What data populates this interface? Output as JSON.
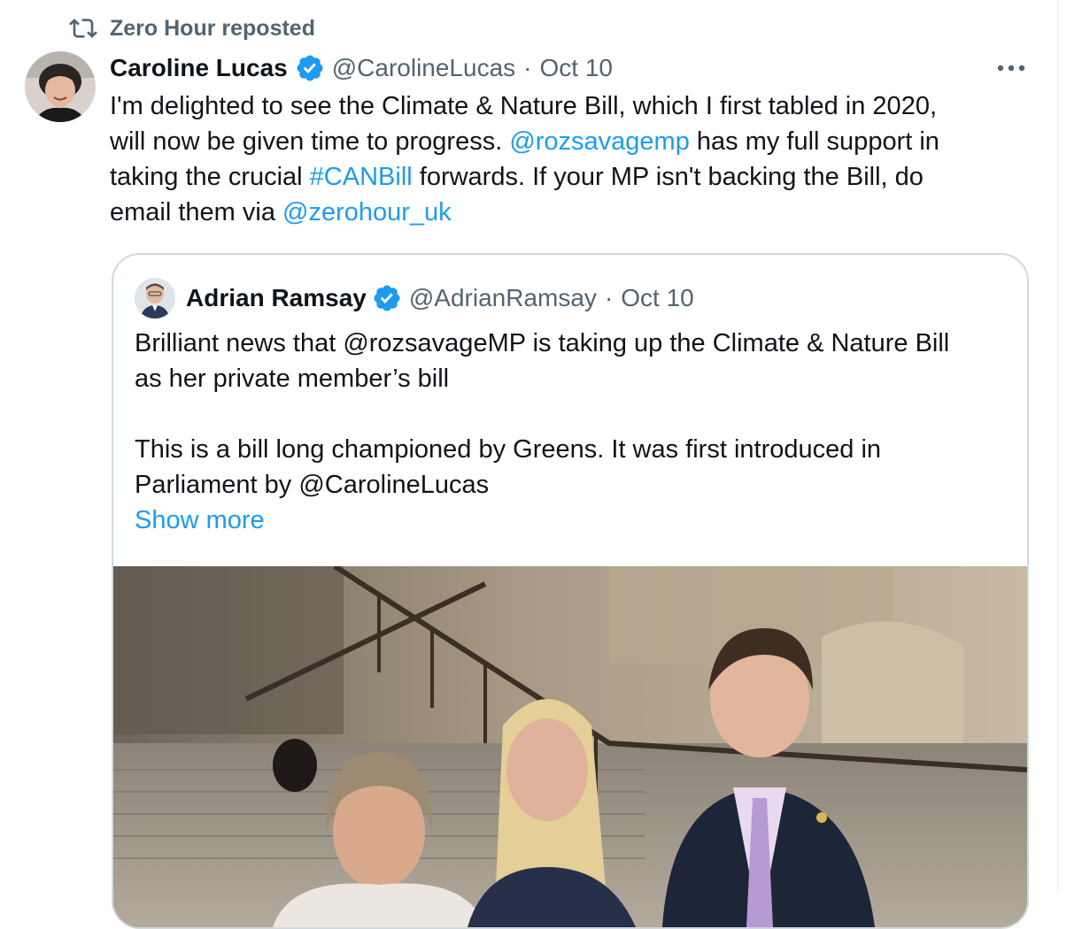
{
  "repost": {
    "label": "Zero Hour reposted",
    "icon": "repost-icon"
  },
  "tweet": {
    "author_name": "Caroline Lucas",
    "handle": "@CarolineLucas",
    "separator": "·",
    "date": "Oct 10",
    "more_icon": "more-icon",
    "body": {
      "line1": "I'm delighted to see the Climate & Nature Bill, which I first tabled in 2020,",
      "line2_pre": "will now be given time to progress. ",
      "mention1": "@rozsavagemp",
      "line2_post": " has my full support in",
      "line3_pre": "taking the crucial ",
      "hashtag": "#CANBill",
      "line3_post": " forwards. If your MP isn't backing the Bill, do",
      "line4_pre": "email them via ",
      "mention2": "@zerohour_uk"
    }
  },
  "quote": {
    "author_name": "Adrian Ramsay",
    "handle": "@AdrianRamsay",
    "separator": "·",
    "date": "Oct 10",
    "text": {
      "l1": "Brilliant news that @rozsavageMP is taking up the Climate & Nature Bill",
      "l2": "as her private member’s bill",
      "l3": "This is a bill long championed by Greens. It was first introduced in",
      "l4": "Parliament by @CarolineLucas"
    },
    "show_more": "Show more"
  },
  "colors": {
    "link": "#1d9bf0",
    "secondary_text": "#536471",
    "primary_text": "#0f1419",
    "verified_badge": "#1d9bf0",
    "border": "#cfd9de"
  }
}
